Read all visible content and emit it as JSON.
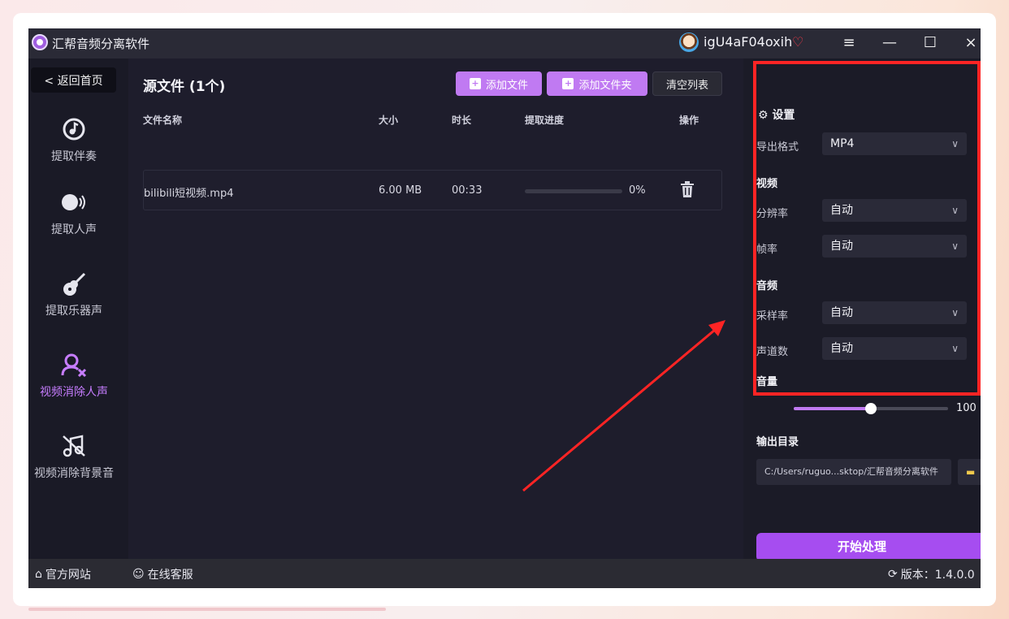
{
  "window": {
    "title": "汇帮音频分离软件",
    "username": "igU4aF04oxih",
    "controls": {
      "menu": "≡",
      "minimize": "—",
      "maximize": "☐",
      "close": "×"
    }
  },
  "sidebar": {
    "back_label": "< 返回首页",
    "items": [
      {
        "label": "提取伴奏",
        "icon": "music-note-icon"
      },
      {
        "label": "提取人声",
        "icon": "voice-icon"
      },
      {
        "label": "提取乐器声",
        "icon": "guitar-icon"
      },
      {
        "label": "视频消除人声",
        "icon": "user-remove-icon",
        "active": true
      },
      {
        "label": "视频消除背景音",
        "icon": "music-off-icon"
      }
    ]
  },
  "main": {
    "title": "源文件 (1个)",
    "buttons": {
      "add_file": "添加文件",
      "add_folder": "添加文件夹",
      "clear_list": "清空列表"
    },
    "columns": [
      "文件名称",
      "大小",
      "时长",
      "提取进度",
      "操作"
    ],
    "files": [
      {
        "name": "bilibili短视频.mp4",
        "size": "6.00 MB",
        "duration": "00:33",
        "progress_text": "0%",
        "progress": 0
      }
    ]
  },
  "settings": {
    "title": "设置",
    "format_label": "导出格式",
    "format_value": "MP4",
    "video_section": "视频",
    "resolution_label": "分辨率",
    "resolution_value": "自动",
    "framerate_label": "帧率",
    "framerate_value": "自动",
    "audio_section": "音频",
    "samplerate_label": "采样率",
    "samplerate_value": "自动",
    "channels_label": "声道数",
    "channels_value": "自动",
    "volume_label": "音量",
    "volume_value": "100",
    "volume_fraction": 0.5,
    "output_label": "输出目录",
    "output_path": "C:/Users/ruguo...sktop/汇帮音频分离软件",
    "start_label": "开始处理"
  },
  "footer": {
    "website": "官方网站",
    "support": "在线客服",
    "version": "版本：1.4.0.0"
  },
  "colors": {
    "accent": "#c07af2",
    "start_button": "#a64df0",
    "highlight_box": "#ff2424"
  }
}
